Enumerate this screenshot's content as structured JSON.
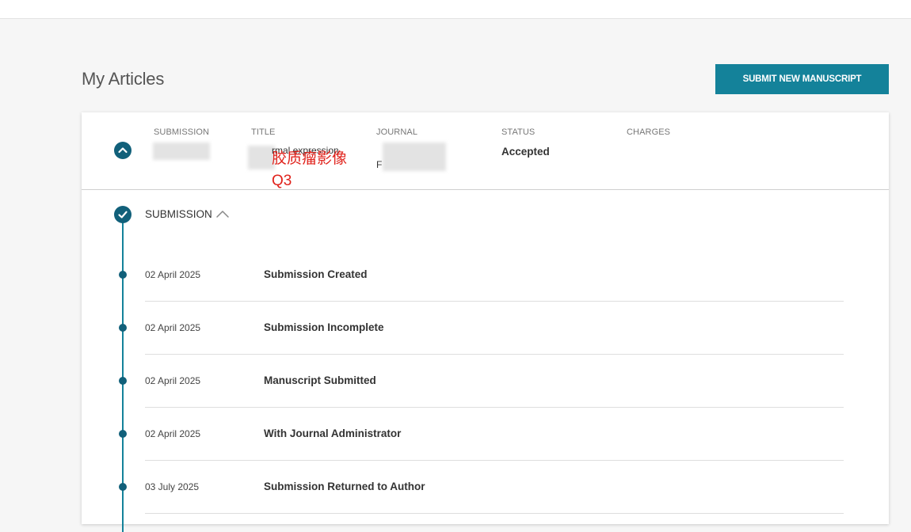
{
  "page": {
    "title": "My Articles",
    "submit_label": "SUBMIT NEW MANUSCRIPT"
  },
  "article": {
    "columns": {
      "submission": "SUBMISSION",
      "title": "TITLE",
      "journal": "JOURNAL",
      "status": "STATUS",
      "charges": "CHARGES"
    },
    "title_snippet": "rmal expression",
    "journal_snippet": "F",
    "status_value": "Accepted",
    "annotation_line1": "胶质瘤影像",
    "annotation_line2": "Q3"
  },
  "timeline": {
    "stage_label": "SUBMISSION",
    "events": [
      {
        "date": "02 April 2025",
        "name": "Submission Created"
      },
      {
        "date": "02 April 2025",
        "name": "Submission Incomplete"
      },
      {
        "date": "02 April 2025",
        "name": "Manuscript Submitted"
      },
      {
        "date": "02 April 2025",
        "name": "With Journal Administrator"
      },
      {
        "date": "03 July 2025",
        "name": "Submission Returned to Author"
      }
    ]
  },
  "colors": {
    "accent": "#14829a",
    "accent_dark": "#11607a",
    "annotation": "#e0221b"
  },
  "icons": {
    "toggle": "chevron-up-icon",
    "stage": "check-circle-icon",
    "stage_toggle": "chevron-up-icon",
    "event": "timeline-dot-icon"
  }
}
